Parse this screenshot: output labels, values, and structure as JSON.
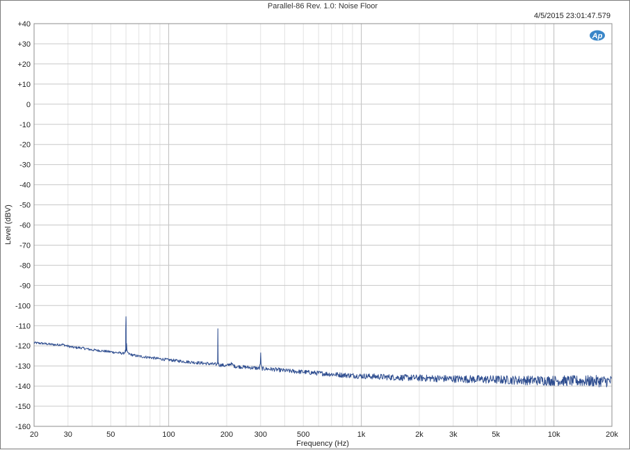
{
  "chart_data": {
    "type": "line",
    "title": "Parallel-86 Rev. 1.0: Noise Floor",
    "timestamp": "4/5/2015 23:01:47.579",
    "logo": "Ap",
    "xlabel": "Frequency (Hz)",
    "ylabel": "Level (dBV)",
    "x_scale": "log",
    "xlim": [
      20,
      20000
    ],
    "ylim": [
      -160,
      40
    ],
    "grid": true,
    "x_ticks": [
      {
        "value": 20,
        "label": "20"
      },
      {
        "value": 30,
        "label": "30"
      },
      {
        "value": 50,
        "label": "50"
      },
      {
        "value": 100,
        "label": "100"
      },
      {
        "value": 200,
        "label": "200"
      },
      {
        "value": 300,
        "label": "300"
      },
      {
        "value": 500,
        "label": "500"
      },
      {
        "value": 1000,
        "label": "1k"
      },
      {
        "value": 2000,
        "label": "2k"
      },
      {
        "value": 3000,
        "label": "3k"
      },
      {
        "value": 5000,
        "label": "5k"
      },
      {
        "value": 10000,
        "label": "10k"
      },
      {
        "value": 20000,
        "label": "20k"
      }
    ],
    "y_ticks": [
      {
        "value": 40,
        "label": "+40"
      },
      {
        "value": 30,
        "label": "+30"
      },
      {
        "value": 20,
        "label": "+20"
      },
      {
        "value": 10,
        "label": "+10"
      },
      {
        "value": 0,
        "label": "0"
      },
      {
        "value": -10,
        "label": "-10"
      },
      {
        "value": -20,
        "label": "-20"
      },
      {
        "value": -30,
        "label": "-30"
      },
      {
        "value": -40,
        "label": "-40"
      },
      {
        "value": -50,
        "label": "-50"
      },
      {
        "value": -60,
        "label": "-60"
      },
      {
        "value": -70,
        "label": "-70"
      },
      {
        "value": -80,
        "label": "-80"
      },
      {
        "value": -90,
        "label": "-90"
      },
      {
        "value": -100,
        "label": "-100"
      },
      {
        "value": -110,
        "label": "-110"
      },
      {
        "value": -120,
        "label": "-120"
      },
      {
        "value": -130,
        "label": "-130"
      },
      {
        "value": -140,
        "label": "-140"
      },
      {
        "value": -150,
        "label": "-150"
      },
      {
        "value": -160,
        "label": "-160"
      }
    ],
    "series": [
      {
        "color": "#2e4d8f",
        "x": [
          20,
          22,
          24,
          26,
          28,
          30,
          32,
          35,
          40,
          45,
          50,
          55,
          58,
          59.5,
          60,
          60.5,
          62,
          65,
          70,
          80,
          90,
          100,
          110,
          120,
          130,
          150,
          170,
          178,
          179.5,
          180,
          180.5,
          182,
          190,
          200,
          210,
          220,
          250,
          280,
          296,
          299.5,
          300,
          300.5,
          304,
          350,
          400,
          450,
          500,
          600,
          700,
          800,
          1000,
          1500,
          2000,
          3000,
          5000,
          7000,
          10000,
          15000,
          20000
        ],
        "y": [
          -118.5,
          -118.8,
          -119.2,
          -119.5,
          -119.3,
          -120.2,
          -120.8,
          -121.0,
          -122.0,
          -122.5,
          -123.0,
          -123.5,
          -123.8,
          -123.0,
          -105.5,
          -122.5,
          -124.0,
          -124.6,
          -125.2,
          -125.8,
          -126.5,
          -127.0,
          -127.4,
          -127.8,
          -128.1,
          -128.6,
          -129.1,
          -129.3,
          -128.0,
          -111.5,
          -128.2,
          -129.5,
          -129.6,
          -130.0,
          -128.8,
          -130.2,
          -130.6,
          -131.0,
          -131.2,
          -128.0,
          -120.5,
          -128.5,
          -131.3,
          -131.7,
          -132.3,
          -132.7,
          -133.0,
          -133.6,
          -134.1,
          -134.5,
          -135.0,
          -135.7,
          -136.0,
          -136.4,
          -136.8,
          -137.1,
          -137.3,
          -137.5,
          -137.6
        ]
      }
    ]
  }
}
